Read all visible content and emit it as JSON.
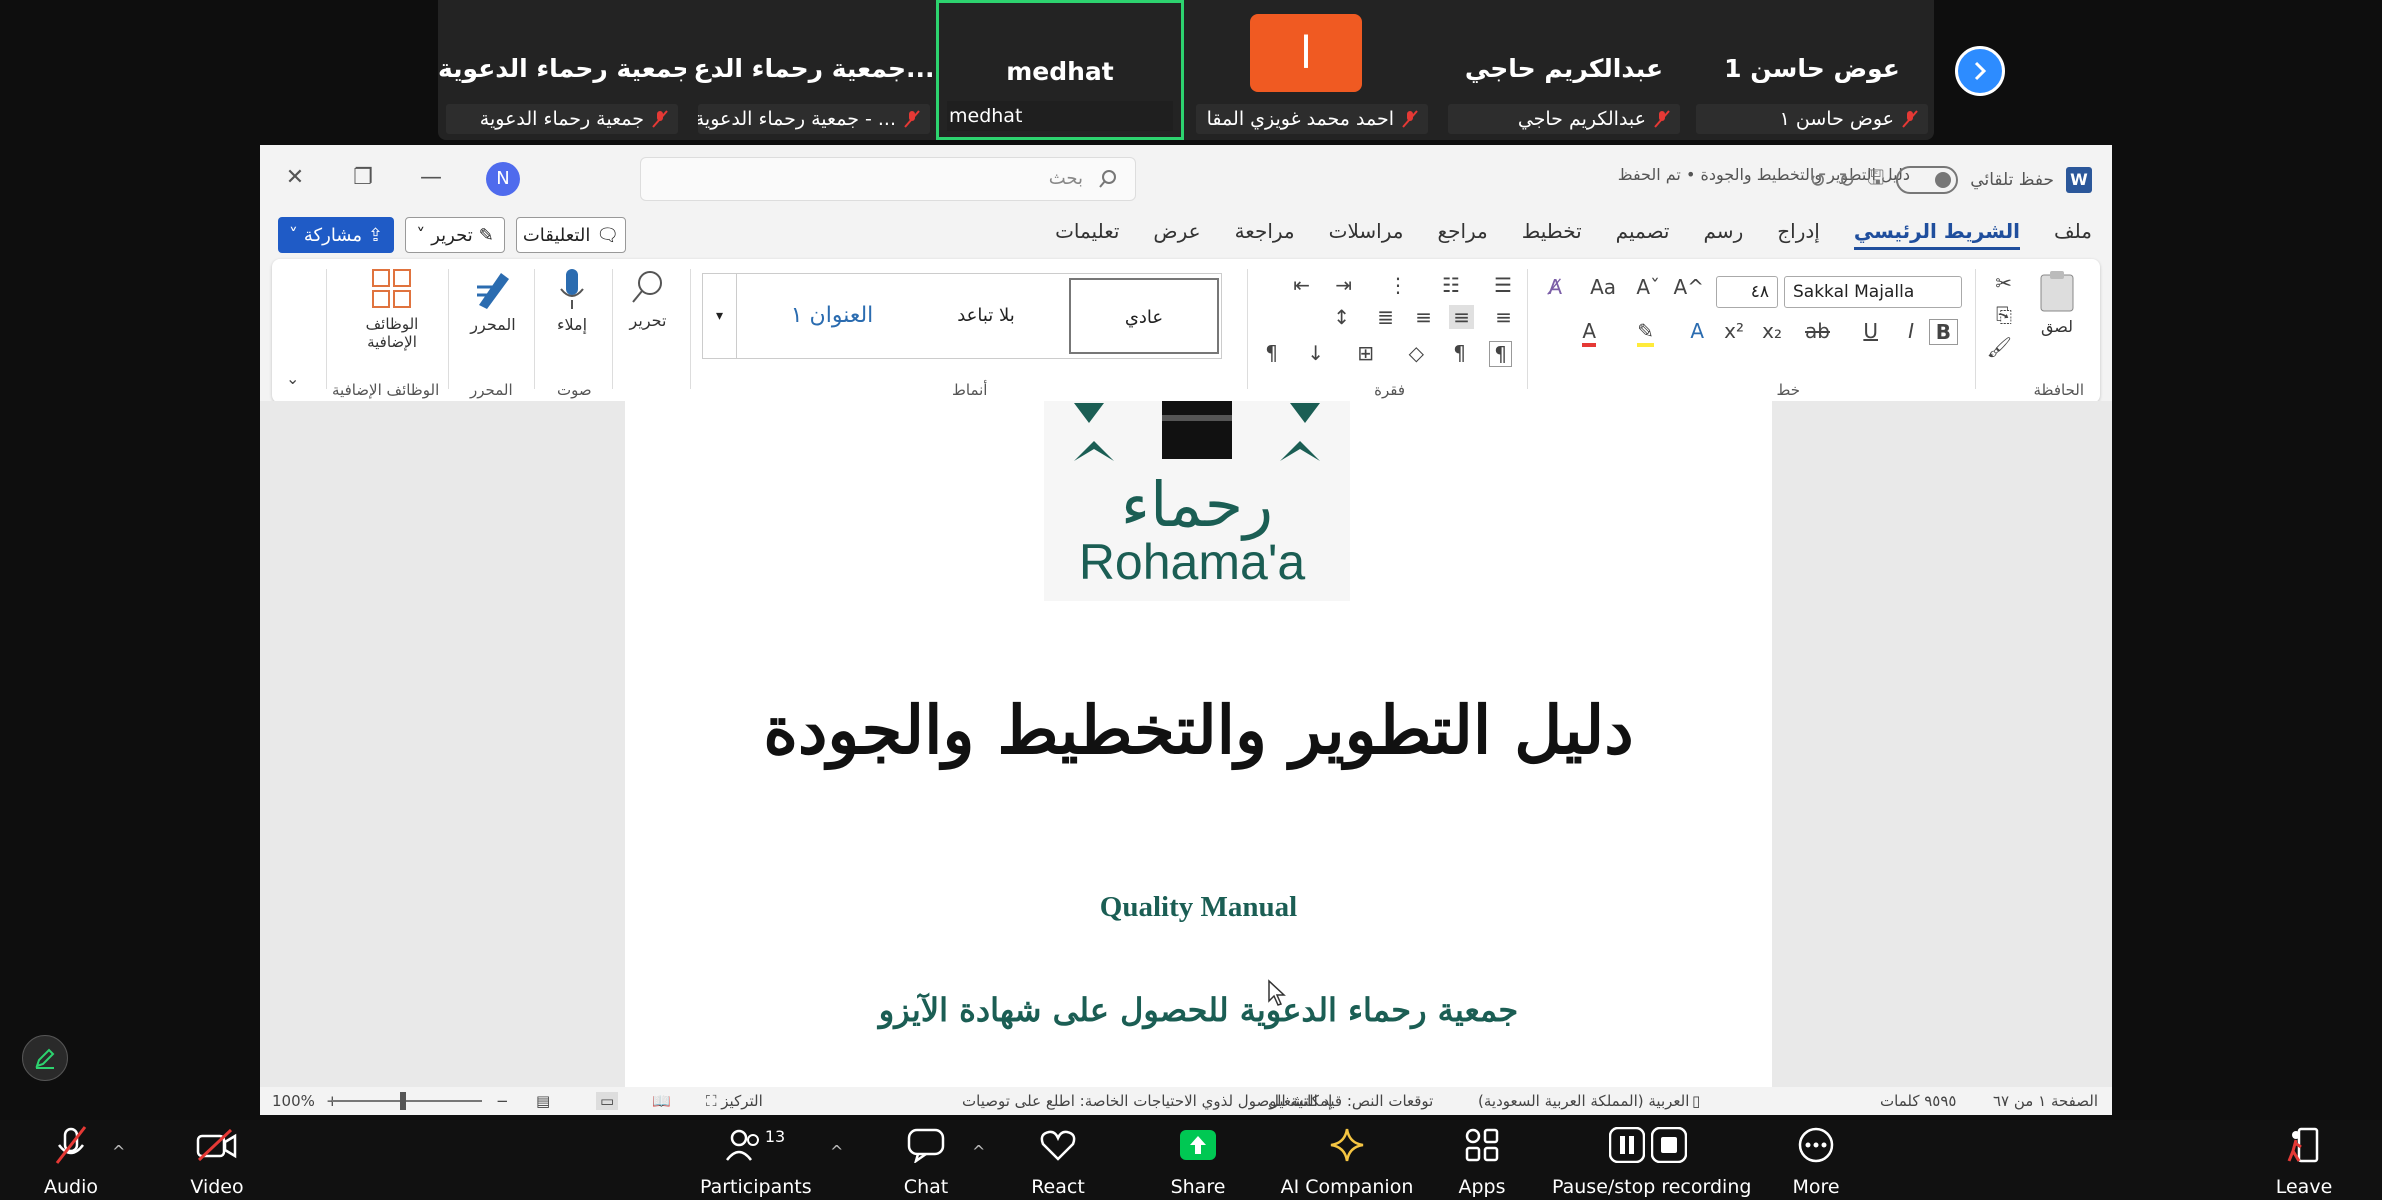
{
  "participants": [
    {
      "name": "جمعية رحماء الدعوية",
      "label": "جمعية رحماء الدعوية",
      "muted": true
    },
    {
      "name": "جمعية رحماء الدع...",
      "label": "... - جمعية رحماء الدعوية",
      "muted": true
    },
    {
      "name": "medhat",
      "label": "medhat",
      "muted": false,
      "active": true
    },
    {
      "name": "ا",
      "label": "احمد محمد غويزي المقا",
      "muted": true
    },
    {
      "name": "عبدالكريم حاجي",
      "label": "عبدالكريم حاجي",
      "muted": true
    },
    {
      "name": "عوض حاسن 1",
      "label": "عوض حاسن ١",
      "muted": true
    }
  ],
  "word": {
    "avatar": "N",
    "search_placeholder": "بحث",
    "doc_title": "دليل التطوير والتخطيط والجودة • تم الحفظ",
    "autosave_label": "حفظ تلقائي",
    "logo_letter": "W",
    "tabs": [
      "ملف",
      "الشريط الرئيسي",
      "إدراج",
      "رسم",
      "تصميم",
      "تخطيط",
      "مراجع",
      "مراسلات",
      "مراجعة",
      "عرض",
      "تعليمات"
    ],
    "active_tab": "الشريط الرئيسي",
    "share_label": "مشاركة",
    "edit_label": "تحرير",
    "comments_label": "التعليقات",
    "ribbon": {
      "clipboard_label": "الحافظة",
      "paste_label": "لصق",
      "font_label": "خط",
      "font_name": "Sakkal Majalla",
      "font_size": "٤٨",
      "paragraph_label": "فقرة",
      "styles_label": "أنماط",
      "styles": [
        "عادي",
        "بلا تباعد",
        "العنوان ١"
      ],
      "editing_label": "تحرير",
      "voice_group_label": "صوت",
      "dictate_label": "إملاء",
      "editor_group_label": "المحرر",
      "editor_label": "المحرر",
      "addins_group_label": "الوظائف الإضافية",
      "addins_label": "الوظائف الإضافية"
    },
    "document": {
      "logo_text_ar": "رحماء",
      "logo_text_en": "Rohama'a",
      "heading": "دليل التطوير والتخطيط والجودة",
      "subtitle_en": "Quality Manual",
      "subtitle_ar": "جمعية رحماء الدعوية للحصول على شهادة الآيزو"
    },
    "status": {
      "page": "الصفحة ١ من ٦٧",
      "words": "٩٥٩٥ كلمات",
      "language": "العربية (المملكة العربية السعودية)",
      "predictions": "توقعات النص: قيد التشغيل",
      "accessibility": "إمكانية الوصول لذوي الاحتياجات الخاصة: اطلع على توصيات",
      "focus": "التركيز",
      "zoom": "100%"
    }
  },
  "toolbar": {
    "audio": "Audio",
    "video": "Video",
    "participants": "Participants",
    "participant_count": "13",
    "chat": "Chat",
    "react": "React",
    "share": "Share",
    "ai": "AI Companion",
    "apps": "Apps",
    "recording": "Pause/stop recording",
    "more": "More",
    "leave": "Leave"
  },
  "colors": {
    "accent": "#2d8cff",
    "share_green": "#00c853",
    "active_border": "#2dd36f",
    "brand_green": "#1b5e54"
  }
}
